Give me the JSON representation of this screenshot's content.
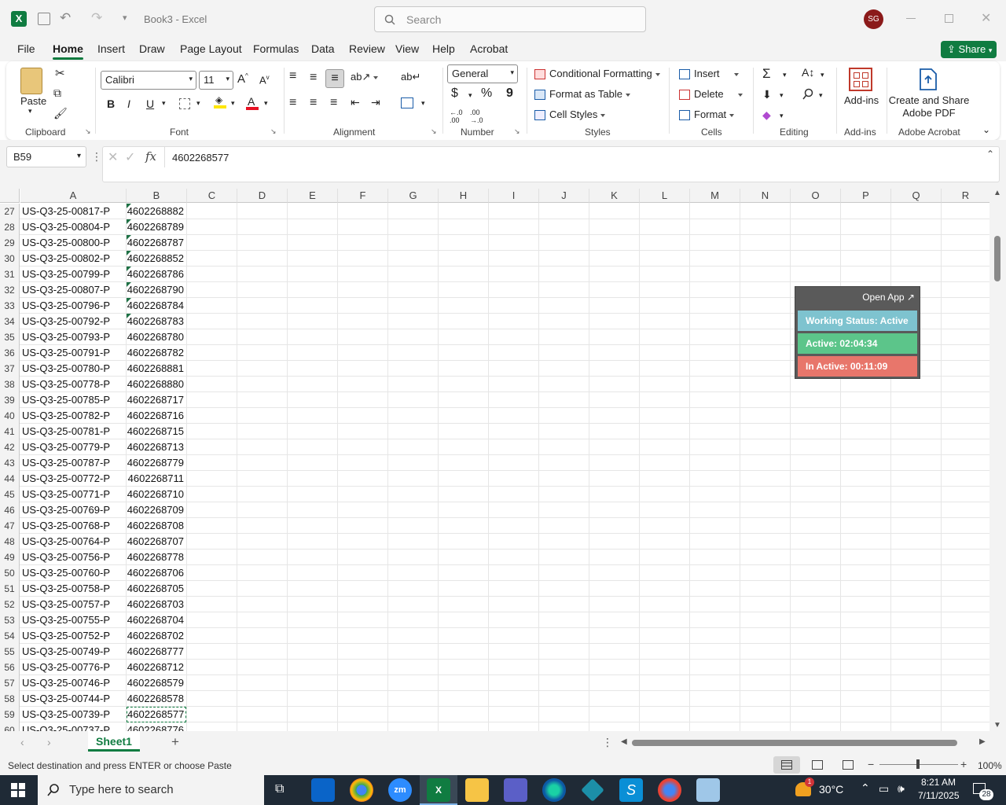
{
  "window": {
    "title": "Book3  -  Excel",
    "search_placeholder": "Search",
    "avatar_initials": "SG"
  },
  "ribbon_tabs": [
    "File",
    "Home",
    "Insert",
    "Draw",
    "Page Layout",
    "Formulas",
    "Data",
    "Review",
    "View",
    "Help",
    "Acrobat"
  ],
  "share_label": "Share",
  "ribbon": {
    "paste_label": "Paste",
    "font_name": "Calibri",
    "font_size": "11",
    "number_format": "General",
    "conditional_formatting": "Conditional Formatting",
    "format_as_table": "Format as Table",
    "cell_styles": "Cell Styles",
    "insert": "Insert",
    "delete": "Delete",
    "format": "Format",
    "addins": "Add-ins",
    "create_share_pdf": "Create and Share Adobe PDF",
    "groups": {
      "clipboard": "Clipboard",
      "font": "Font",
      "alignment": "Alignment",
      "number": "Number",
      "styles": "Styles",
      "cells": "Cells",
      "editing": "Editing",
      "addins": "Add-ins",
      "adobe": "Adobe Acrobat"
    }
  },
  "formula_bar": {
    "name_box": "B59",
    "fx": "fx",
    "formula": "4602268577"
  },
  "columns": [
    "A",
    "B",
    "C",
    "D",
    "E",
    "F",
    "G",
    "H",
    "I",
    "J",
    "K",
    "L",
    "M",
    "N",
    "O",
    "P",
    "Q",
    "R"
  ],
  "rows": [
    {
      "n": "27",
      "a": "US-Q3-25-00817-P",
      "b": "4602268882",
      "err": true
    },
    {
      "n": "28",
      "a": "US-Q3-25-00804-P",
      "b": "4602268789",
      "err": true
    },
    {
      "n": "29",
      "a": "US-Q3-25-00800-P",
      "b": "4602268787",
      "err": true
    },
    {
      "n": "30",
      "a": "US-Q3-25-00802-P",
      "b": "4602268852",
      "err": true
    },
    {
      "n": "31",
      "a": "US-Q3-25-00799-P",
      "b": "4602268786",
      "err": true
    },
    {
      "n": "32",
      "a": "US-Q3-25-00807-P",
      "b": "4602268790",
      "err": true
    },
    {
      "n": "33",
      "a": "US-Q3-25-00796-P",
      "b": "4602268784",
      "err": true
    },
    {
      "n": "34",
      "a": "US-Q3-25-00792-P",
      "b": "4602268783",
      "err": true
    },
    {
      "n": "35",
      "a": "US-Q3-25-00793-P",
      "b": "4602268780",
      "err": false
    },
    {
      "n": "36",
      "a": "US-Q3-25-00791-P",
      "b": "4602268782",
      "err": false
    },
    {
      "n": "37",
      "a": "US-Q3-25-00780-P",
      "b": "4602268881",
      "err": false
    },
    {
      "n": "38",
      "a": "US-Q3-25-00778-P",
      "b": "4602268880",
      "err": false
    },
    {
      "n": "39",
      "a": "US-Q3-25-00785-P",
      "b": "4602268717",
      "err": false
    },
    {
      "n": "40",
      "a": "US-Q3-25-00782-P",
      "b": "4602268716",
      "err": false
    },
    {
      "n": "41",
      "a": "US-Q3-25-00781-P",
      "b": "4602268715",
      "err": false
    },
    {
      "n": "42",
      "a": "US-Q3-25-00779-P",
      "b": "4602268713",
      "err": false
    },
    {
      "n": "43",
      "a": "US-Q3-25-00787-P",
      "b": "4602268779",
      "err": false
    },
    {
      "n": "44",
      "a": "US-Q3-25-00772-P",
      "b": "4602268711",
      "err": false
    },
    {
      "n": "45",
      "a": "US-Q3-25-00771-P",
      "b": "4602268710",
      "err": false
    },
    {
      "n": "46",
      "a": "US-Q3-25-00769-P",
      "b": "4602268709",
      "err": false
    },
    {
      "n": "47",
      "a": "US-Q3-25-00768-P",
      "b": "4602268708",
      "err": false
    },
    {
      "n": "48",
      "a": "US-Q3-25-00764-P",
      "b": "4602268707",
      "err": false
    },
    {
      "n": "49",
      "a": "US-Q3-25-00756-P",
      "b": "4602268778",
      "err": false
    },
    {
      "n": "50",
      "a": "US-Q3-25-00760-P",
      "b": "4602268706",
      "err": false
    },
    {
      "n": "51",
      "a": "US-Q3-25-00758-P",
      "b": "4602268705",
      "err": false
    },
    {
      "n": "52",
      "a": "US-Q3-25-00757-P",
      "b": "4602268703",
      "err": false
    },
    {
      "n": "53",
      "a": "US-Q3-25-00755-P",
      "b": "4602268704",
      "err": false
    },
    {
      "n": "54",
      "a": "US-Q3-25-00752-P",
      "b": "4602268702",
      "err": false
    },
    {
      "n": "55",
      "a": "US-Q3-25-00749-P",
      "b": "4602268777",
      "err": false
    },
    {
      "n": "56",
      "a": "US-Q3-25-00776-P",
      "b": "4602268712",
      "err": false
    },
    {
      "n": "57",
      "a": "US-Q3-25-00746-P",
      "b": "4602268579",
      "err": false
    },
    {
      "n": "58",
      "a": "US-Q3-25-00744-P",
      "b": "4602268578",
      "err": false
    },
    {
      "n": "59",
      "a": "US-Q3-25-00739-P",
      "b": "4602268577",
      "err": false,
      "selected": true
    },
    {
      "n": "60",
      "a": "US-Q3-25-00737-P",
      "b": "4602268776",
      "err": false
    }
  ],
  "widget": {
    "open_app": "Open App ↗",
    "working_status": "Working Status: Active",
    "active": "Active: 02:04:34",
    "inactive": "In Active: 00:11:09",
    "colors": {
      "status": "#7ec3cf",
      "active": "#5cc58a",
      "inactive": "#e8766b"
    }
  },
  "sheet_tab": "Sheet1",
  "status_text": "Select destination and press ENTER or choose Paste",
  "zoom": "100%",
  "taskbar": {
    "search_placeholder": "Type here to search",
    "temperature": "30°C",
    "time": "8:21 AM",
    "date": "7/11/2025",
    "notification_count": "28",
    "weather_badge": "1"
  }
}
